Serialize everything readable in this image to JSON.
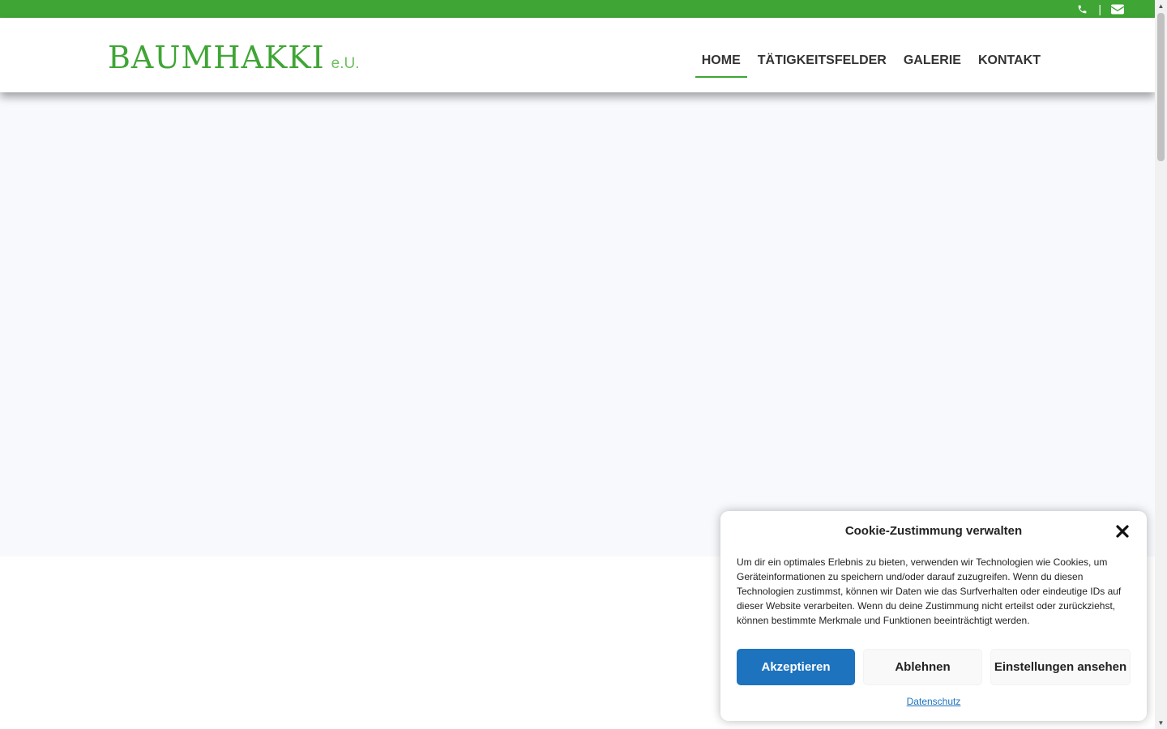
{
  "topbar": {
    "background": "#3fa535",
    "phone_icon": "phone-icon",
    "separator": "|",
    "email_icon": "envelope-icon"
  },
  "header": {
    "logo": {
      "main": "BAUMHAKKI",
      "suffix": "e.U."
    },
    "nav": {
      "items": [
        {
          "label": "HOME",
          "active": true
        },
        {
          "label": "TÄTIGKEITSFELDER",
          "active": false
        },
        {
          "label": "GALERIE",
          "active": false
        },
        {
          "label": "KONTAKT",
          "active": false
        }
      ]
    }
  },
  "colors": {
    "brand_green": "#3fa535",
    "accent_blue": "#1e73be",
    "hero_bg": "#f7f9fc"
  },
  "cookie_banner": {
    "title": "Cookie-Zustimmung verwalten",
    "close_icon": "close-icon",
    "text": "Um dir ein optimales Erlebnis zu bieten, verwenden wir Technologien wie Cookies, um Geräteinformationen zu speichern und/oder darauf zuzugreifen. Wenn du diesen Technologien zustimmst, können wir Daten wie das Surfverhalten oder eindeutige IDs auf dieser Website verarbeiten. Wenn du deine Zustimmung nicht erteilst oder zurückziehst, können bestimmte Merkmale und Funktionen beeinträchtigt werden.",
    "buttons": {
      "accept": "Akzeptieren",
      "deny": "Ablehnen",
      "settings": "Einstellungen ansehen"
    },
    "link": "Datenschutz"
  }
}
